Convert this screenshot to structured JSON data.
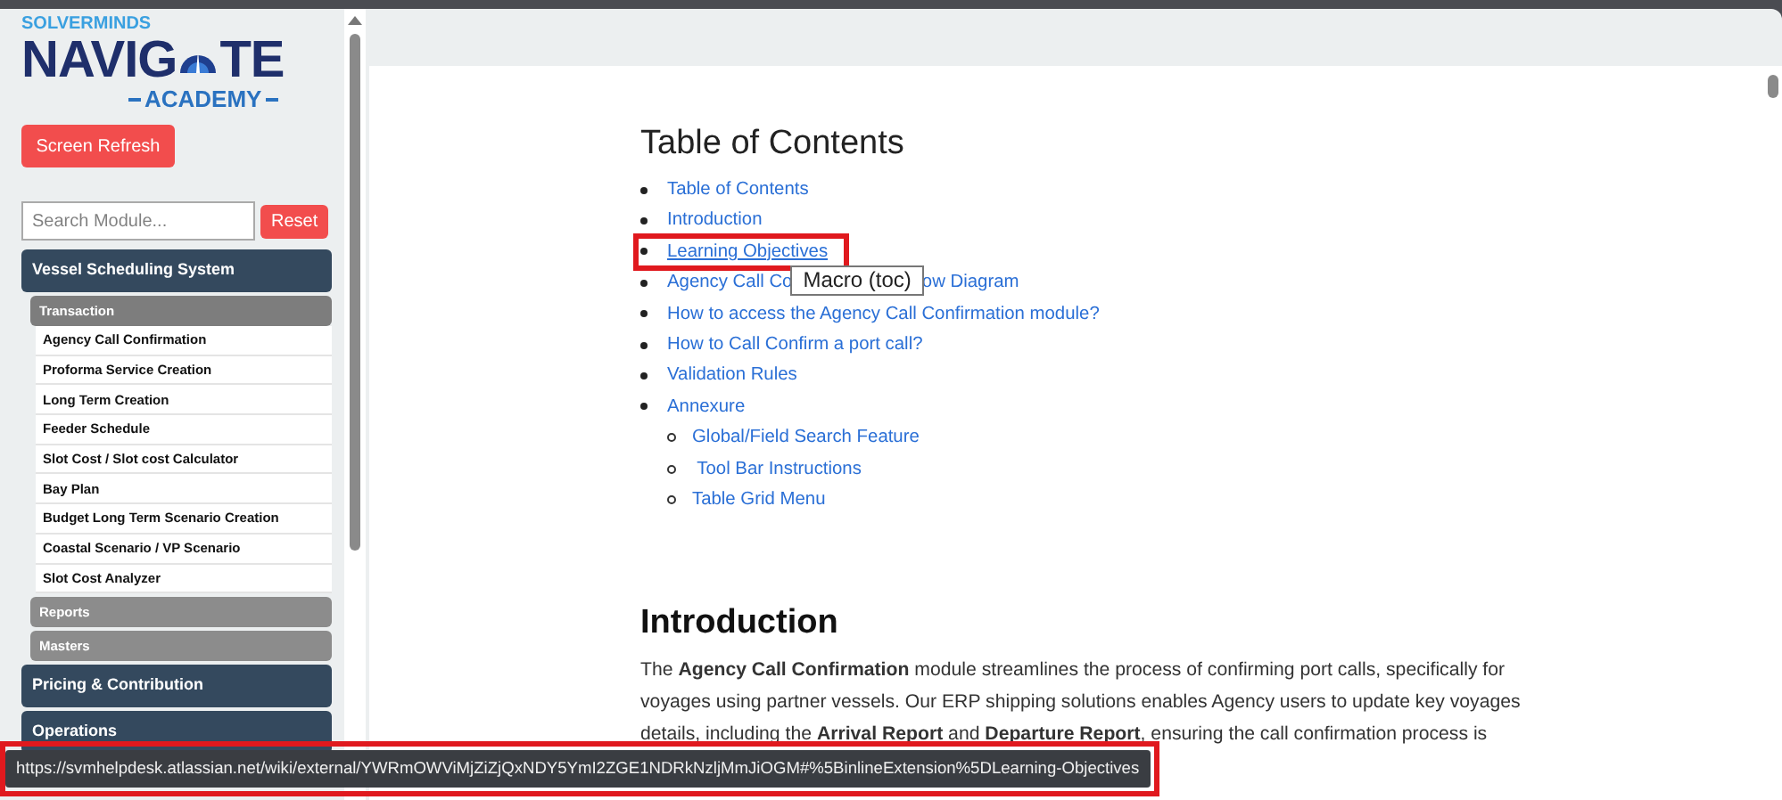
{
  "logo": {
    "brand": "SOLVERMINDS",
    "name_left": "NAVIG",
    "name_right": "TE",
    "subtitle": "ACADEMY"
  },
  "refresh_button": "Screen Refresh",
  "search": {
    "placeholder": "Search Module...",
    "reset": "Reset"
  },
  "menu": [
    {
      "label": "Vessel Scheduling System",
      "sections": [
        {
          "label": "Transaction",
          "expanded": true,
          "items": [
            "Agency Call Confirmation",
            "Proforma Service Creation",
            "Long Term Creation",
            "Feeder Schedule",
            "Slot Cost / Slot cost Calculator",
            "Bay Plan",
            "Budget Long Term Scenario Creation",
            "Coastal Scenario / VP Scenario",
            "Slot Cost Analyzer"
          ]
        },
        {
          "label": "Reports",
          "expanded": false
        },
        {
          "label": "Masters",
          "expanded": false
        }
      ]
    },
    {
      "label": "Pricing & Contribution"
    },
    {
      "label": "Operations"
    }
  ],
  "toc": {
    "title": "Table of Contents",
    "items": [
      {
        "text": "Table of Contents",
        "highlighted": false,
        "hovered": false
      },
      {
        "text": "Introduction",
        "highlighted": false,
        "hovered": false
      },
      {
        "text": "Learning Objectives",
        "highlighted": true,
        "hovered": true
      },
      {
        "text": "Agency Call Co",
        "tooltip": "Macro (toc)",
        "text_after": "ow Diagram",
        "highlighted": false,
        "hovered": false
      },
      {
        "text": "How to access the Agency Call Confirmation module?",
        "highlighted": false,
        "hovered": false
      },
      {
        "text": "How to Call Confirm a port call?",
        "highlighted": false,
        "hovered": false
      },
      {
        "text": "Validation Rules",
        "highlighted": false,
        "hovered": false
      },
      {
        "text": "Annexure",
        "highlighted": false,
        "hovered": false,
        "children": [
          {
            "text": "Global/Field Search Feature",
            "highlighted": false,
            "hovered": false
          },
          {
            "text": " Tool Bar Instructions",
            "highlighted": false,
            "hovered": false
          },
          {
            "text": "Table Grid Menu",
            "highlighted": false,
            "hovered": false
          }
        ]
      }
    ]
  },
  "introduction": {
    "title": "Introduction",
    "paragraph_lines": [
      "The **Agency Call Confirmation** module streamlines the process of confirming port calls, specifically for",
      "voyages using partner vessels. Our ERP shipping solutions enables Agency users to update key voyages",
      "details, including the **Arrival Report** and **Departure Report**, ensuring the call confirmation process is"
    ]
  },
  "status_url": {
    "text": "https://svmhelpdesk.atlassian.net/wiki/external/YWRmOWViMjZiZjQxNDY5YmI2ZGE1NDRkNzljMmJiOGM#%5BinlineExtension%5DLearning-Objectives",
    "highlighted": true
  }
}
